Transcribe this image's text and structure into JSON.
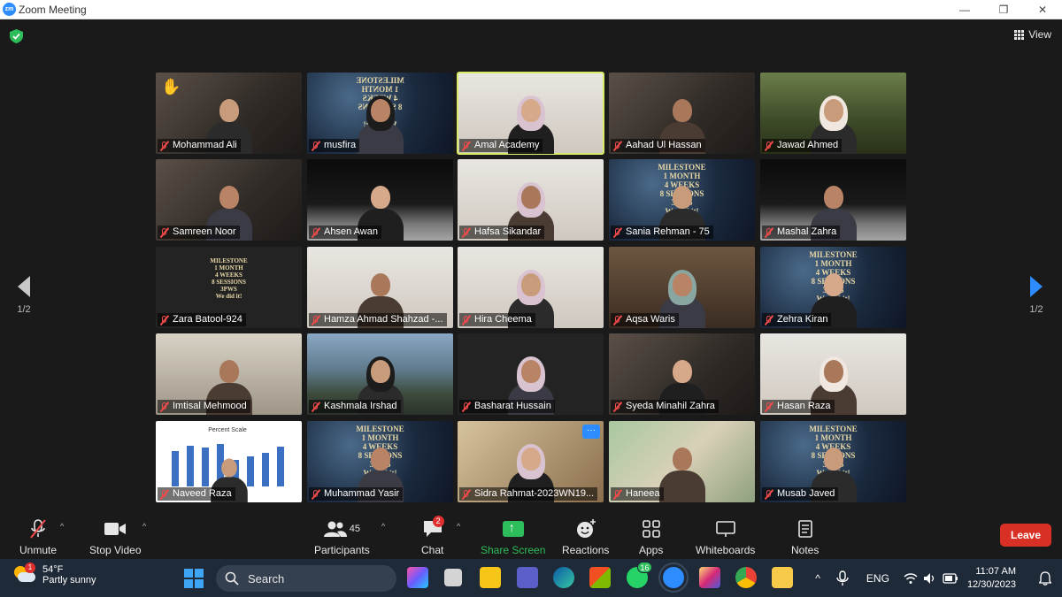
{
  "window": {
    "logo_text": "zm",
    "title": "Zoom Meeting",
    "minimize_glyph": "—",
    "restore_glyph": "❐",
    "close_glyph": "✕"
  },
  "header": {
    "view_label": "View"
  },
  "pagination": {
    "left": "1/2",
    "right": "1/2"
  },
  "participants": [
    {
      "name": "Mohammad Ali",
      "bg": "bg-room",
      "style": "hand"
    },
    {
      "name": "musfira",
      "bg": "bg-space",
      "style": "milestone-mirror"
    },
    {
      "name": "Amal Academy",
      "bg": "bg-white",
      "style": "active"
    },
    {
      "name": "Aahad Ul Hassan",
      "bg": "bg-room",
      "style": "person"
    },
    {
      "name": "Jawad Ahmed",
      "bg": "bg-forest",
      "style": "person"
    },
    {
      "name": "Samreen Noor",
      "bg": "bg-room",
      "style": "person"
    },
    {
      "name": "Ahsen Awan",
      "bg": "bg-moon",
      "style": "person"
    },
    {
      "name": "Hafsa Sikandar",
      "bg": "bg-white",
      "style": "person"
    },
    {
      "name": "Sania Rehman - 75",
      "bg": "bg-space",
      "style": "milestone"
    },
    {
      "name": "Mashal Zahra",
      "bg": "bg-moon",
      "style": "person"
    },
    {
      "name": "Zara Batool-924",
      "bg": "bg-dark",
      "style": "milestone-small"
    },
    {
      "name": "Hamza Ahmad Shahzad -...",
      "bg": "bg-white",
      "style": "person"
    },
    {
      "name": "Hira Cheema",
      "bg": "bg-white",
      "style": "person"
    },
    {
      "name": "Aqsa Waris",
      "bg": "bg-library",
      "style": "person"
    },
    {
      "name": "Zehra Kiran",
      "bg": "bg-space",
      "style": "milestone"
    },
    {
      "name": "Imtisal Mehmood",
      "bg": "bg-office",
      "style": "person"
    },
    {
      "name": "Kashmala Irshad",
      "bg": "bg-mountain",
      "style": "person"
    },
    {
      "name": "Basharat Hussain",
      "bg": "bg-dark",
      "style": "person"
    },
    {
      "name": "Syeda Minahil Zahra",
      "bg": "bg-room",
      "style": "person"
    },
    {
      "name": "Hasan Raza",
      "bg": "bg-white",
      "style": "person"
    },
    {
      "name": "Naveed Raza",
      "bg": "bg-chart",
      "style": "chart"
    },
    {
      "name": "Muhammad Yasir",
      "bg": "bg-space",
      "style": "milestone"
    },
    {
      "name": "Sidra Rahmat-2023WN19...",
      "bg": "bg-blur",
      "style": "dots"
    },
    {
      "name": "Haneea",
      "bg": "bg-garden",
      "style": "person"
    },
    {
      "name": "Musab Javed",
      "bg": "bg-space",
      "style": "milestone"
    }
  ],
  "milestone_text": [
    "MILESTONE",
    "1 MONTH",
    "4 WEEKS",
    "8 SESSIONS",
    "3PWS",
    "We did it!"
  ],
  "mini_chart": {
    "title": "Percent Scale"
  },
  "toolbar": {
    "unmute": "Unmute",
    "stop_video": "Stop Video",
    "participants": "Participants",
    "participants_count": "45",
    "chat": "Chat",
    "chat_badge": "2",
    "share_screen": "Share Screen",
    "reactions": "Reactions",
    "apps": "Apps",
    "whiteboards": "Whiteboards",
    "notes": "Notes",
    "leave": "Leave",
    "caret": "^",
    "more_dots": "···"
  },
  "taskbar": {
    "weather_temp": "54°F",
    "weather_desc": "Partly sunny",
    "weather_badge": "1",
    "search_placeholder": "Search",
    "whatsapp_badge": "16",
    "language": "ENG",
    "time": "11:07 AM",
    "date": "12/30/2023"
  },
  "colors": {
    "accent_blue": "#2d8cff",
    "leave_red": "#d93025",
    "share_green": "#2dbd5a",
    "active_speaker": "#d9ec6a"
  }
}
